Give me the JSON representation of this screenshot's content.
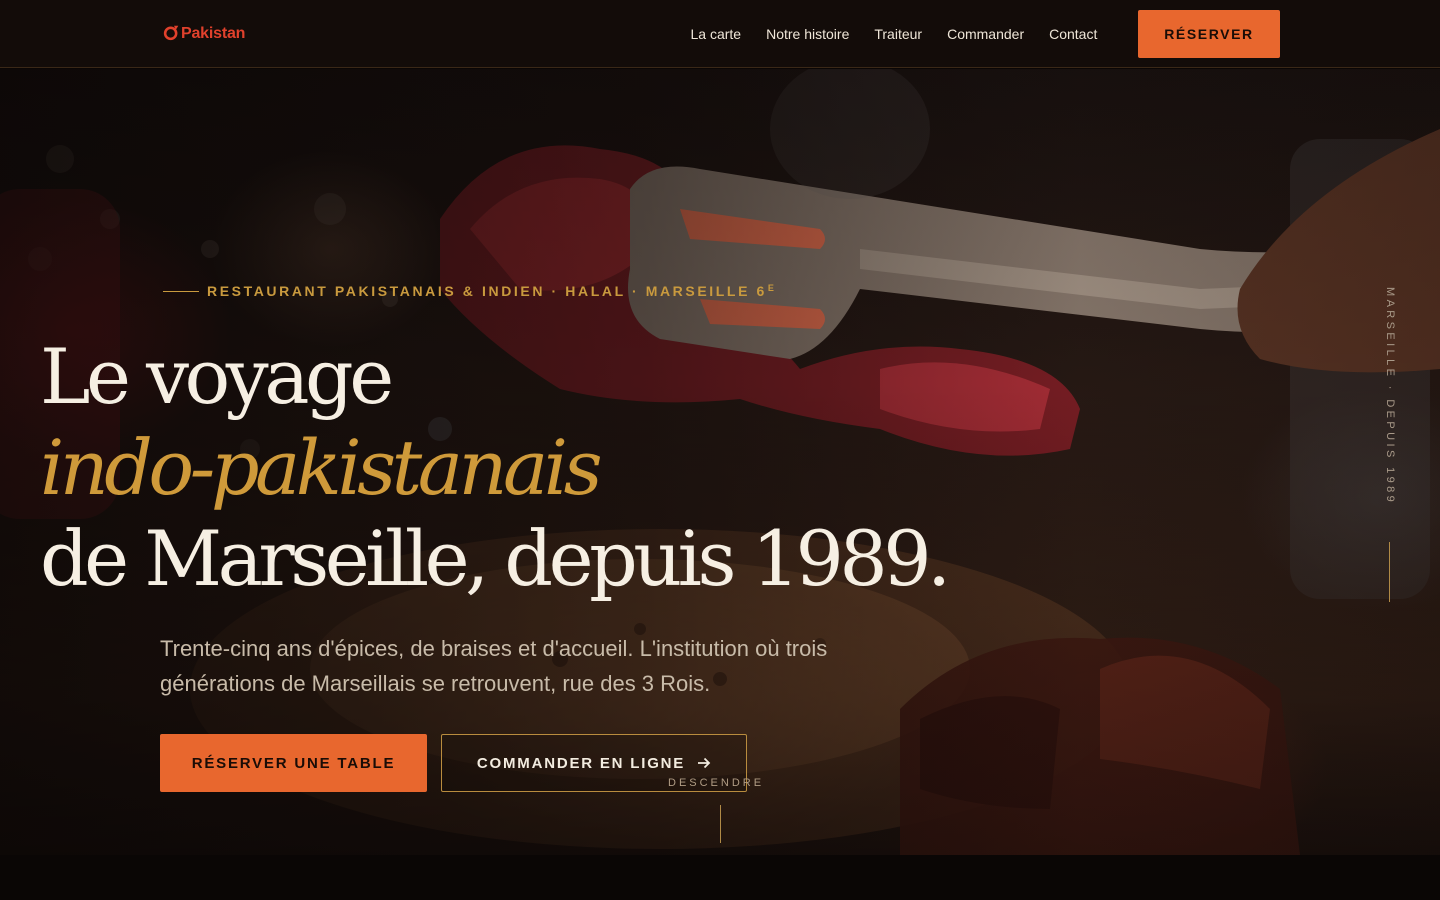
{
  "brand": {
    "logo_text": "Pakistan",
    "logo_icon": "o-ring-logo-icon",
    "color": "#e0412c"
  },
  "nav": {
    "items": [
      {
        "label": "La carte"
      },
      {
        "label": "Notre histoire"
      },
      {
        "label": "Traiteur"
      },
      {
        "label": "Commander"
      },
      {
        "label": "Contact"
      }
    ],
    "reserve_label": "RÉSERVER"
  },
  "hero": {
    "eyebrow_text": "RESTAURANT PAKISTANAIS & INDIEN · HALAL · MARSEILLE 6",
    "eyebrow_sup": "E",
    "headline": {
      "line1": "Le voyage",
      "line2": "indo-pakistanais",
      "line3": "de Marseille, depuis 1989."
    },
    "lede": "Trente-cinq ans d'épices, de braises et d'accueil. L'institution où trois générations de Marseillais se retrouvent, rue des 3 Rois.",
    "cta_primary": "RÉSERVER UNE TABLE",
    "cta_secondary": "COMMANDER EN LIGNE",
    "cta_secondary_icon": "arrow-right-icon",
    "scroll_label": "DESCENDRE",
    "side_tag": "MARSEILLE · DEPUIS 1989"
  },
  "colors": {
    "accent_orange": "#e8672e",
    "accent_gold": "#cf9a3a",
    "text_cream": "#f6efe3",
    "background": "#0a0605"
  }
}
